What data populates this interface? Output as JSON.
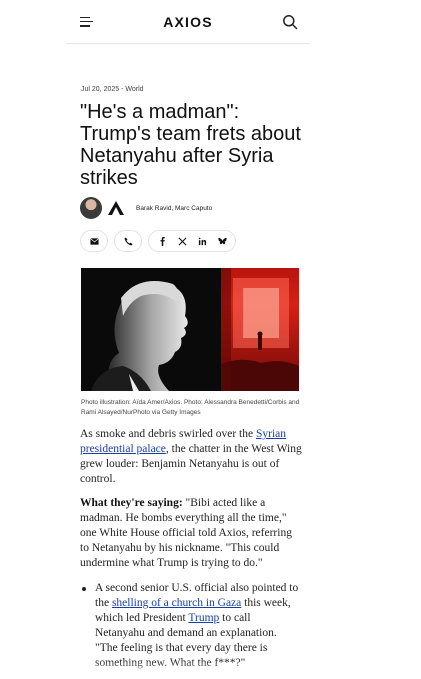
{
  "header": {
    "logo": "AXIOS",
    "menu_icon": "menu-icon",
    "search_icon": "search-icon"
  },
  "article": {
    "meta": "Jul 20, 2025 - World",
    "headline": "\"He's a madman\": Trump's team frets about Netanyahu after Syria strikes",
    "byline": "Barak Ravid, Marc Caputo",
    "share_buttons": [
      "email-icon",
      "phone-icon",
      "facebook-icon",
      "x-icon",
      "linkedin-icon",
      "bluesky-icon"
    ],
    "caption": "Photo illustration: Aïda Amer/Axios. Photo: Alessandra Benedetti/Corbis and Rami Alsayed/NurPhoto via Getty Images",
    "p1": {
      "before": "As smoke and debris swirled over the ",
      "link": "Syrian presidential palace",
      "after": ", the chatter in the West Wing grew louder: Benjamin Netanyahu is out of control."
    },
    "p2": {
      "lead": "What they're saying:",
      "text": " \"Bibi acted like a madman. He bombs everything all the time,\" one White House official told Axios, referring to Netanyahu by his nickname. \"This could undermine what Trump is trying to do.\""
    },
    "bullet": {
      "before": "A second senior U.S. official also pointed to the ",
      "link1": "shelling of a church in Gaza",
      "mid": " this week, which led President ",
      "link2": "Trump",
      "after": " to call Netanyahu and demand an explanation. \"The feeling is that every day there is something new. What the f***?\""
    }
  },
  "colors": {
    "link": "#1a3ea8",
    "text": "#222222",
    "photo_red": "#d62016"
  }
}
